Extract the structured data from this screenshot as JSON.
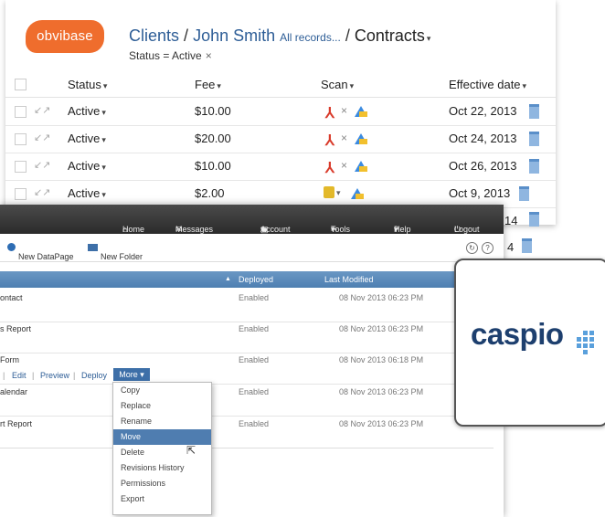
{
  "obvibase": {
    "logo": "obvibase",
    "breadcrumb": {
      "clients": "Clients",
      "slash1": "/",
      "person": "John Smith",
      "all_records": "All records...",
      "slash2": "/",
      "current": "Contracts",
      "caret": "▾"
    },
    "filter": {
      "text": "Status = Active",
      "remove": "×"
    },
    "columns": [
      "Status",
      "Fee",
      "Scan",
      "Effective date"
    ],
    "rows": [
      {
        "status": "Active",
        "fee": "$10.00",
        "date": "Oct 22, 2013"
      },
      {
        "status": "Active",
        "fee": "$20.00",
        "date": "Oct 24, 2013"
      },
      {
        "status": "Active",
        "fee": "$10.00",
        "date": "Oct 26, 2013"
      },
      {
        "status": "Active",
        "fee": "$2.00",
        "date": "Oct 9, 2013"
      }
    ],
    "overflow_dates": [
      "14",
      "4"
    ],
    "caret": "▾",
    "delete_glyph": "×",
    "pdf_glyph": "⅄",
    "expand_glyph": "↙↗",
    "accent_color": "#ef6d2d"
  },
  "caspio": {
    "topbar": {
      "home": "Home",
      "messages": "Messages",
      "account": "Account",
      "tools": "Tools",
      "help": "Help",
      "logout": "Logout"
    },
    "toolbar": {
      "new_datapage": "New DataPage",
      "new_folder": "New Folder"
    },
    "grid_headers": {
      "deployed": "Deployed",
      "last_modified": "Last Modified"
    },
    "rows": [
      {
        "name": "ontact",
        "status": "Enabled",
        "date": "08 Nov 2013 06:23 PM"
      },
      {
        "name": "s Report",
        "status": "Enabled",
        "date": "08 Nov 2013 06:23 PM"
      },
      {
        "name": "Form",
        "status": "Enabled",
        "date": "08 Nov 2013 06:18 PM"
      },
      {
        "name": "alendar",
        "status": "Enabled",
        "date": "08 Nov 2013 06:23 PM"
      },
      {
        "name": "rt Report",
        "status": "Enabled",
        "date": "08 Nov 2013 06:23 PM"
      }
    ],
    "row_actions": {
      "edit": "Edit",
      "preview": "Preview",
      "deploy": "Deploy",
      "more": "More"
    },
    "more_menu": [
      "Copy",
      "Replace",
      "Rename",
      "Move",
      "Delete",
      "Revisions History",
      "Permissions",
      "Export"
    ],
    "highlight_item": "Move",
    "logo_card": {
      "text": "caspio"
    },
    "brand_color": "#1d3f6e"
  }
}
